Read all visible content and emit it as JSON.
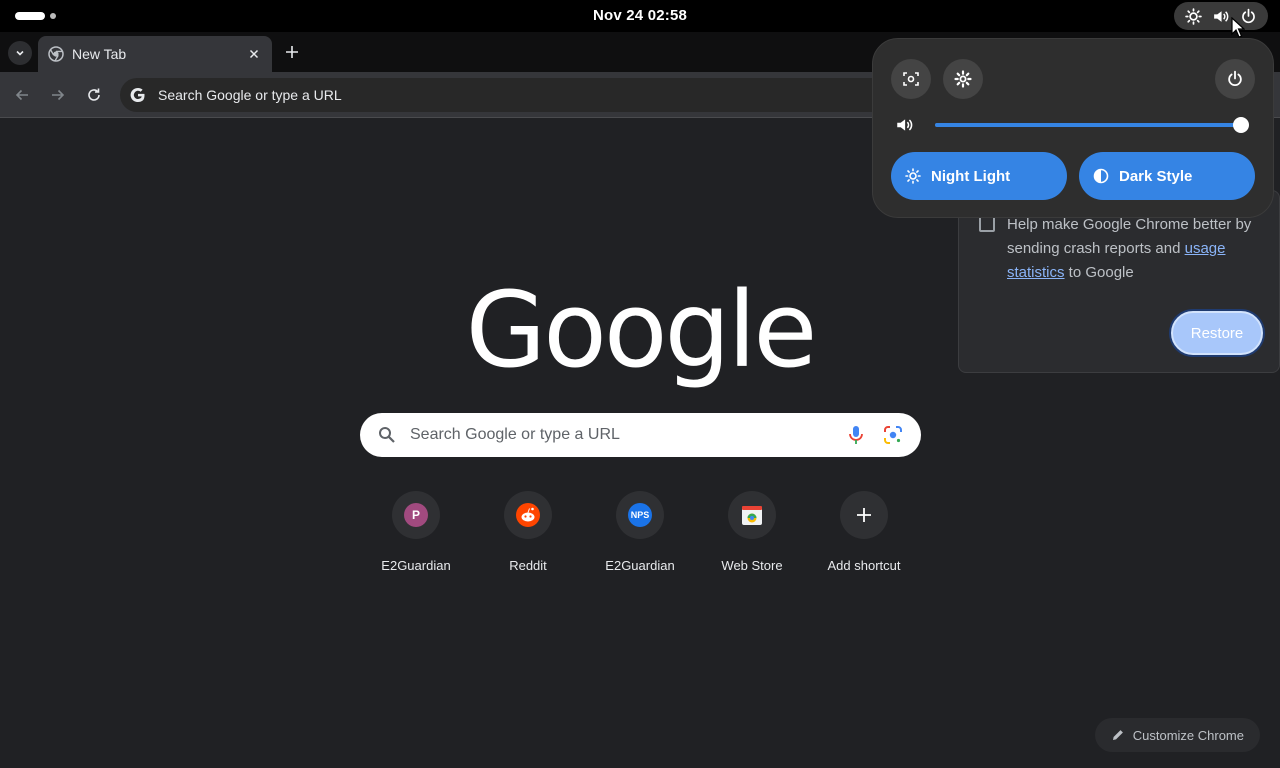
{
  "topbar": {
    "clock": "Nov 24  02:58",
    "tray_icons": [
      "brightness-icon",
      "volume-icon",
      "power-icon"
    ]
  },
  "browser": {
    "tab_title": "New Tab",
    "omnibox_placeholder": "Search Google or type a URL"
  },
  "ntp": {
    "logo": "Google",
    "search_placeholder": "Search Google or type a URL",
    "shortcuts": [
      {
        "label": "E2Guardian",
        "glyph": "P",
        "color": "#a14a7f"
      },
      {
        "label": "Reddit",
        "glyph": "",
        "color": "#ff4500"
      },
      {
        "label": "E2Guardian",
        "glyph": "NPS",
        "color": "#1a73e8"
      },
      {
        "label": "Web Store",
        "glyph": "",
        "color": "#ffffff"
      },
      {
        "label": "Add shortcut",
        "glyph": "+",
        "color": "#2f3033"
      }
    ],
    "customize_label": "Customize Chrome"
  },
  "dialog": {
    "text_before": "Help make Google Chrome better by sending crash reports and ",
    "link_text": "usage statistics",
    "text_after": " to Google",
    "checkbox_checked": false,
    "restore_label": "Restore"
  },
  "quick_settings": {
    "volume_level_percent": 100,
    "night_light_label": "Night Light",
    "dark_style_label": "Dark Style",
    "accent_color": "#3584e4"
  }
}
